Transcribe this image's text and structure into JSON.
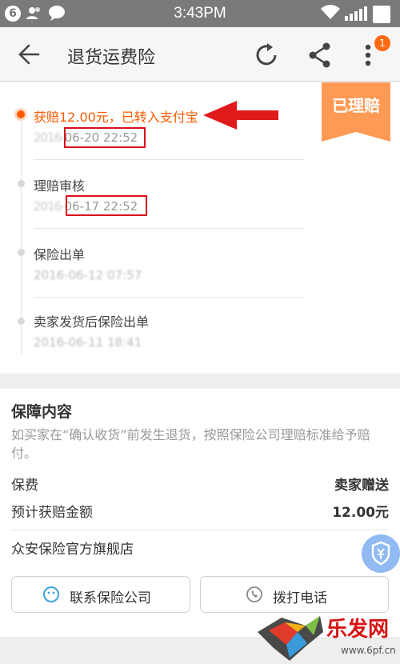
{
  "status_bar": {
    "notification_count": "6",
    "time": "3:43PM"
  },
  "header": {
    "title": "退货运费险",
    "more_badge": "1",
    "icons": [
      "back-arrow-icon",
      "refresh-icon",
      "share-icon",
      "more-vertical-icon"
    ]
  },
  "claim_status_badge": "已理赔",
  "timeline": [
    {
      "title": "获赔12.00元，已转入支付宝",
      "date_hidden": "2016-",
      "date_visible": "06-20 22:52",
      "active": true
    },
    {
      "title": "理赔审核",
      "date_hidden": "2016-",
      "date_visible": "06-17 22:52",
      "active": false
    },
    {
      "title": "保险出单",
      "date": "2016-06-12 07:57",
      "active": false
    },
    {
      "title": "卖家发货后保险出单",
      "date": "2016-06-11 18:41",
      "active": false
    }
  ],
  "coverage": {
    "title": "保障内容",
    "description": "如买家在“确认收货”前发生退货，按照保险公司理赔标准给予赔付。",
    "premium_label": "保费",
    "premium_value": "卖家赠送",
    "expected_label": "预计获赔金额",
    "expected_value": "12.00元",
    "store_name": "众安保险官方旗舰店",
    "contact_button": "联系保险公司",
    "call_button": "拨打电话"
  },
  "watermark": {
    "text": "乐发网",
    "url": "www.6pf.cn"
  },
  "colors": {
    "accent": "#ff5a00",
    "highlight_border": "#d9101d",
    "ribbon": "#ff9a55"
  }
}
